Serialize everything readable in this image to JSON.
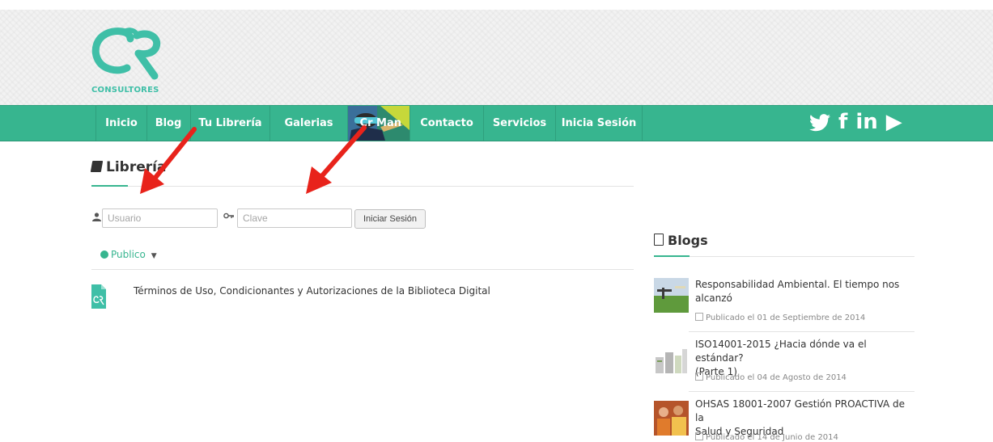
{
  "logo": {
    "text": "CONSULTORES"
  },
  "nav": {
    "items": [
      {
        "label": "Inicio"
      },
      {
        "label": "Blog"
      },
      {
        "label": "Tu Librería"
      },
      {
        "label": "Galerias"
      },
      {
        "label": "Cr Man"
      },
      {
        "label": "Contacto"
      },
      {
        "label": "Servicios"
      },
      {
        "label": "Inicia Sesión"
      }
    ]
  },
  "social": {
    "twitter": "twitter-icon",
    "facebook": "f",
    "linkedin": "in",
    "youtube": "▶"
  },
  "library": {
    "title": "Librería",
    "username_placeholder": "Usuario",
    "password_placeholder": "Clave",
    "login_button": "Iniciar Sesión",
    "filter_label": "Publico",
    "document_title": "Términos de Uso, Condicionantes y Autorizaciones de la Biblioteca Digital"
  },
  "blogs": {
    "title": "Blogs",
    "posts": [
      {
        "title_line1": "Responsabilidad Ambiental. El tiempo nos",
        "title_line2": "alcanzó",
        "date": "Publicado el 01 de Septiembre de 2014"
      },
      {
        "title_line1": "ISO14001-2015 ¿Hacia dónde va el estándar?",
        "title_line2": "(Parte 1)",
        "date": "Publicado el 04 de Agosto de 2014"
      },
      {
        "title_line1": "OHSAS 18001-2007 Gestión PROACTIVA de la",
        "title_line2": "Salud y Seguridad",
        "date": "Publicado el 14 de Junio de 2014"
      }
    ]
  },
  "colors": {
    "accent": "#37b58f",
    "annotation_arrow": "#e8231b"
  }
}
